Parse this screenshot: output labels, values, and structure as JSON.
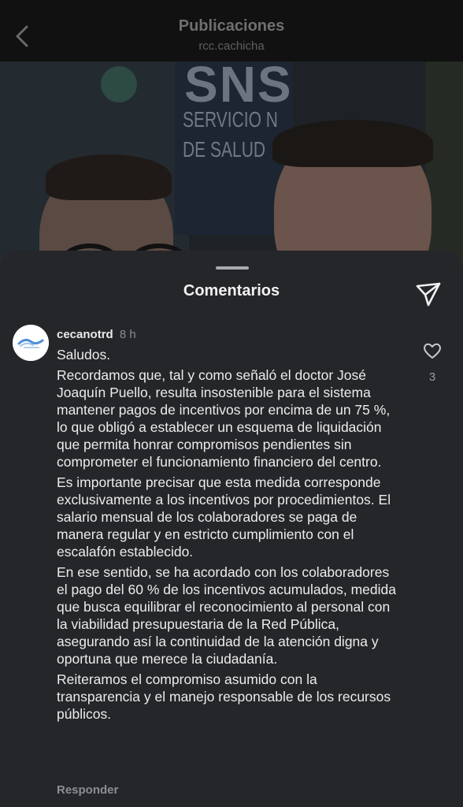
{
  "header": {
    "title": "Publicaciones",
    "subtitle": "rcc.cachicha"
  },
  "photo": {
    "sign_big": "SNS",
    "sign_line1": "SERVICIO N",
    "sign_line2": "DE SALUD"
  },
  "comments_sheet": {
    "title": "Comentarios"
  },
  "comment": {
    "username": "cecanotrd",
    "time": "8 h",
    "paragraphs": [
      "Saludos.",
      "Recordamos que, tal y como señaló el doctor José Joaquín Puello, resulta insostenible para el sistema mantener pagos de incentivos por encima de un 75 %, lo que obligó a establecer un esquema de liquidación que permita honrar compromisos pendientes sin comprometer el funcionamiento financiero del  centro.",
      "Es importante precisar que esta medida corresponde exclusivamente a los incentivos por procedimientos. El salario mensual de los colaboradores se paga de manera regular y en estricto cumplimiento con el escalafón establecido.",
      "En ese sentido, se ha acordado con los colaboradores el pago del 60 % de los incentivos acumulados, medida que busca equilibrar el reconocimiento al personal con la viabilidad presupuestaria de la Red Pública, asegurando así la continuidad de la atención digna y oportuna que merece la ciudadanía.",
      "Reiteramos el compromiso asumido con la transparencia y el manejo responsable de los recursos públicos."
    ],
    "like_count": "3",
    "reply_label": "Responder"
  },
  "icons": {
    "back": "chevron-left-icon",
    "share": "paper-plane-icon",
    "like": "heart-icon"
  },
  "colors": {
    "sheet_bg": "#25262a",
    "header_bg": "#111111",
    "text_primary": "#ececec",
    "text_secondary": "#8b8b90"
  }
}
